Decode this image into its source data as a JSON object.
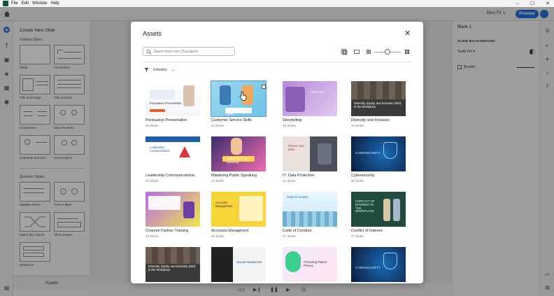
{
  "menubar": {
    "items": [
      "File",
      "Edit",
      "Window",
      "Help"
    ],
    "win_ctrls": [
      "–",
      "☐",
      "✕"
    ]
  },
  "toolbar": {
    "zoom": "Best Fit",
    "preview_label": "Preview",
    "more_label": "···"
  },
  "create_panel": {
    "title": "Create New Slide",
    "content_section": "Content Slides",
    "question_section": "Question Slides",
    "content_slides": [
      "Blank",
      "Introduction",
      "Title and image",
      "Title and text",
      "Comparison",
      "Meet the team",
      "Character and text",
      "Conversation"
    ],
    "question_slides": [
      "Multiple choice",
      "True or false",
      "Match the column",
      "Short answer",
      "Sequence"
    ],
    "assets_label": "Assets"
  },
  "properties": {
    "title": "Blank 1",
    "section": "SLIDE BACKGROUND",
    "fill": "Solid Fill",
    "border": "Border"
  },
  "modal": {
    "title": "Assets",
    "close": "✕",
    "search_placeholder": "Search from over 25 projects",
    "filter_label": "Industry",
    "cards": [
      {
        "title": "Persuasive Presentation",
        "count": "55 Slides",
        "theme": "persuasive",
        "img_text": "Persuasive Presentation"
      },
      {
        "title": "Customer Service Skills",
        "count": "64 Slides",
        "theme": "customer",
        "img_text": "Customer Service Skills",
        "selected": true
      },
      {
        "title": "Storytelling",
        "count": "49 Slides",
        "theme": "story",
        "img_text": "Story Play"
      },
      {
        "title": "Diversity and Inclusion",
        "count": "45 Slides",
        "theme": "diversity",
        "img_text": "Diversity, Equity, and Inclusion (DEI) in the Workplace"
      },
      {
        "title": "Leadership Communications",
        "count": "57 Slides",
        "theme": "leadership",
        "img_text": "Leadership Communication"
      },
      {
        "title": "Mastering Public Speaking",
        "count": "47 Slides",
        "theme": "speaking",
        "img_text": "Mastering Public Speaking"
      },
      {
        "title": "IT- Data Protection",
        "count": "44 Slides",
        "theme": "dataprot",
        "img_text": "Protect Your Data"
      },
      {
        "title": "Cybersecurity",
        "count": "60 Slides",
        "theme": "cyber",
        "img_text": "CYBERSECURITY"
      },
      {
        "title": "Channel Partner Training",
        "count": "49 Slides",
        "theme": "channel",
        "img_text": "Channel Partner Training"
      },
      {
        "title": "Accounts Managment",
        "count": "49 Slides",
        "theme": "accounts",
        "img_text": "Accounts Management"
      },
      {
        "title": "Code of Conduct",
        "count": "47 Slides",
        "theme": "conduct",
        "img_text": "Code of conduct"
      },
      {
        "title": "Conflict of Interest",
        "count": "57 Slides",
        "theme": "conflict",
        "img_text": "CONFLICT OF INTEREST IN THE WORKPLACE"
      },
      {
        "title": "",
        "count": "",
        "theme": "diversity2",
        "img_text": "Diversity, Equity, and Inclusion (DEI) in the Workplace"
      },
      {
        "title": "",
        "count": "",
        "theme": "harass",
        "img_text": "Sexual Harassment"
      },
      {
        "title": "",
        "count": "",
        "theme": "privacy",
        "img_text": "Promoting Patient Privacy"
      },
      {
        "title": "",
        "count": "",
        "theme": "cyber2",
        "img_text": "CYBERSECURITY"
      }
    ]
  },
  "colors": {
    "accent": "#1f6fd8",
    "selection": "#5b8fd9"
  }
}
